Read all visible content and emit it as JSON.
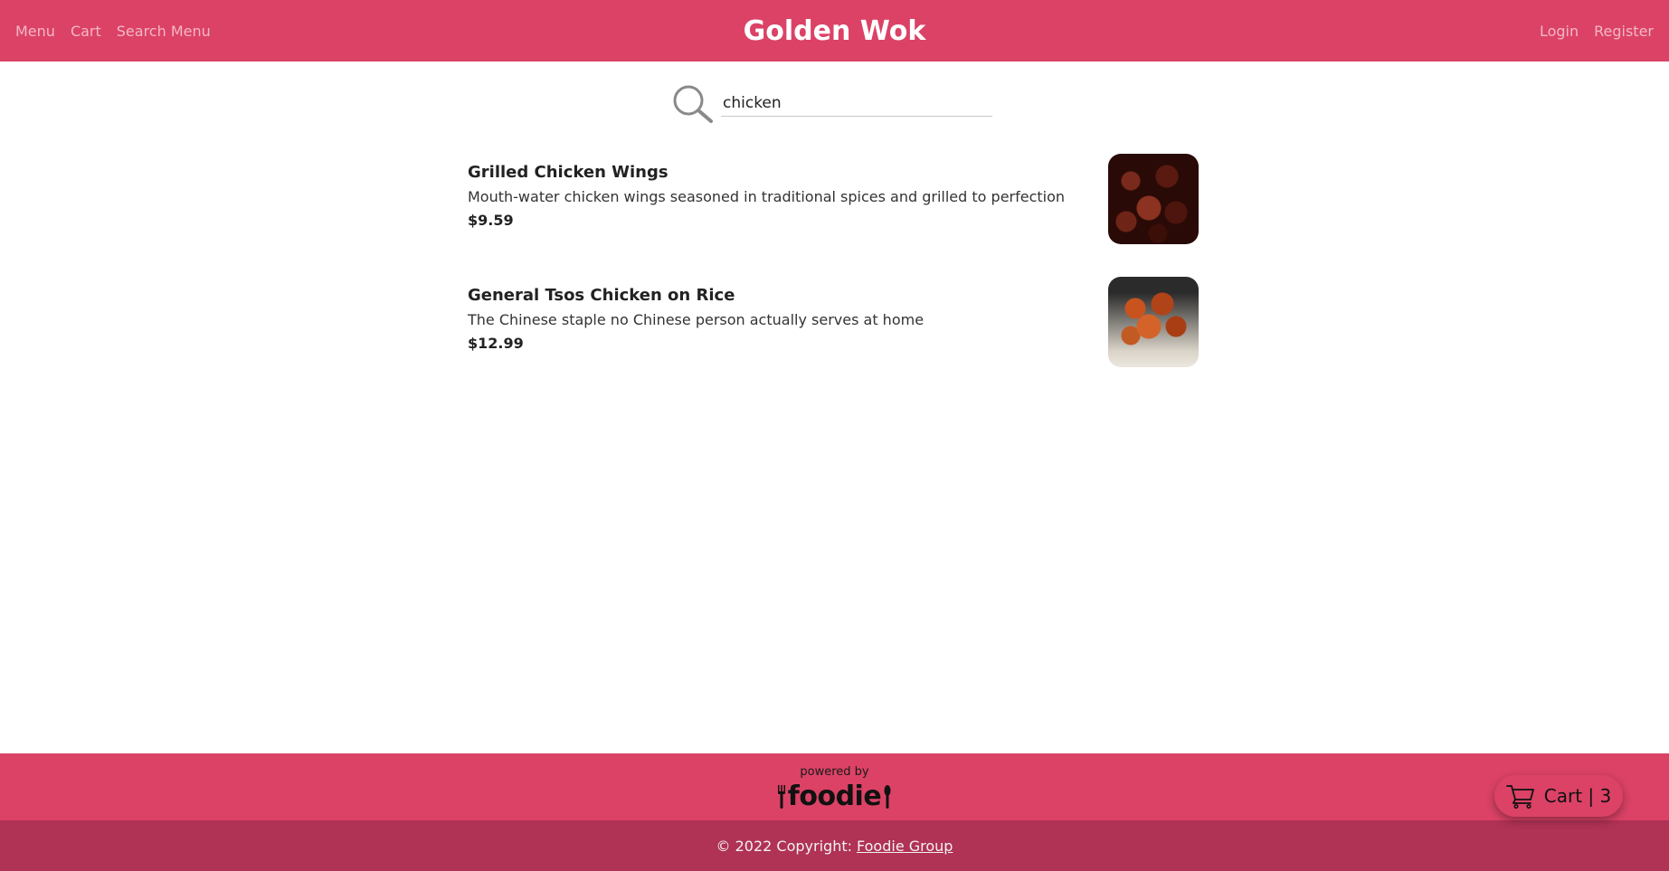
{
  "header": {
    "brand": "Golden Wok",
    "nav_left": [
      "Menu",
      "Cart",
      "Search Menu"
    ],
    "nav_right": [
      "Login",
      "Register"
    ]
  },
  "search": {
    "value": "chicken",
    "icon": "search-icon"
  },
  "results": [
    {
      "name": "Grilled Chicken Wings",
      "description": "Mouth-water chicken wings seasoned in traditional spices and grilled to perfection",
      "price": "$9.59"
    },
    {
      "name": "General Tsos Chicken on Rice",
      "description": "The Chinese staple no Chinese person actually serves at home",
      "price": "$12.99"
    }
  ],
  "footer": {
    "powered_by": "powered by",
    "logo_text": "foodie",
    "copyright": "© 2022 Copyright:",
    "link": "Foodie Group"
  },
  "cart_button": {
    "label": "Cart | 3",
    "icon": "cart-icon"
  },
  "colors": {
    "primary": "#db4266",
    "footer_dark": "#b03255",
    "nav_text": "#f4b7c6"
  }
}
